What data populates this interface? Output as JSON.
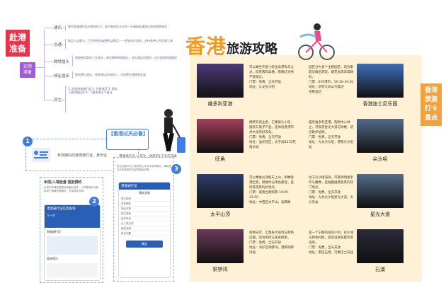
{
  "left_tag": "赴港\n准备",
  "center_tag": "实用\n准备",
  "mindmap": {
    "items": [
      {
        "label": "通讯",
        "desc": "使用港澳通行证办理电话卡；或下载电话卡应用—开通国际漫游后再到香港使用"
      },
      {
        "label": "交通",
        "desc": "购买八达通卡；可于地铁站或便利店购买——地铁出行首选，支持多种公共交通工具"
      },
      {
        "label": "跨境插头",
        "desc": "香港使用英标三孔插头，建议携带转换插头；部分酒店可借用，出行前提前准备好"
      },
      {
        "label": "预定酒店",
        "desc": "提前预订酒店；香港酒店房间较小，可选择交通便利区域"
      },
      {
        "label": "其它",
        "desc": "1. 办理港澳通行证 2. 兑换港币 3. 提前下载地图应用 4. 了解香港天气情况"
      }
    ]
  },
  "left_panel": {
    "step1": "1",
    "step1_text": "有效期内的港澳通行证、身份证",
    "step2": "2",
    "step2_title": "出境/入境检查 提前预约",
    "step2_text": "出境口岸通关需提前准备好证件，入境香港后可使用电子通道快速通关，节省排队时间。",
    "step3": "3",
    "bubble_title": "【香港过关必备】",
    "bubble_text": "港澳通行证 + 签注，请提前1个工作日确认签注有效",
    "step3_text": "签注信息可在小程序或公众号中查询确认，确保签注在有效期内并留意使用次数。",
    "phone1_header": "港澳通行证信息查询",
    "phone1_sub": "下一步",
    "phone1_label": "港澳通行证",
    "phone1_footer": "查询签注",
    "phone2_header": "港澳通行证",
    "phone2_title": "通关须知",
    "phone2_rows": [
      "签注种类",
      "有效期至",
      "剩余次数",
      "签注类别",
      "证件状态",
      "出入境记录",
      "相关说明",
      "常见问题"
    ],
    "phone2_button": "确定"
  },
  "guide": {
    "title_big": "香港",
    "title_small": "旅游攻略",
    "side_tag": "香港\n旅游\n打卡\n景点",
    "cells": [
      {
        "caption": "维多利亚港",
        "text": "可以乘坐天星小轮往返港岛与九龙，欣赏两岸高楼，夜晚灯光秀不容错过。\n门票：免费，全天开放\n地址：九龙尖沙咀",
        "color": "#4b3a7a"
      },
      {
        "caption": "香港迪士尼乐园",
        "text": "园区分为多个主题园区，适合家庭与情侣游玩，烟花表演非常精彩。\n门票：639港币，10:30-19:30\n地址：新界大屿山竹篙湾\n地铁直达",
        "color": "#3f6fb8"
      },
      {
        "caption": "旺角",
        "text": "拥挤的商业街，汇集街头小吃、服装与电子产品，是体验香港市井文化的好去处。\n门票：免费，全天开放\n地址：油尖旺区，太子站B2口/旺角东站",
        "color": "#a0405a"
      },
      {
        "caption": "尖沙咀",
        "text": "临近维多利亚港，购物中心林立，可观赏星光大道与钟楼，适合散步拍照。\n门票：免费，全天开放\n地址：九龙尖沙咀，港铁尖沙咀站",
        "color": "#556a8a"
      },
      {
        "caption": "太平山顶",
        "text": "可以乘坐山顶缆车上山，俯瞰香港全景，傍晚时分景色最佳，是欣赏夜景的好地点。\n门票：观景台需购票 10:00-22:00\n地址：中西区太平山，凌霄阁",
        "color": "#2e3d6a"
      },
      {
        "caption": "星光大道",
        "text": "位于尖沙咀海滨，可看到明星手印与雕像，是拍摄维港夜景的热门地点。\n门票：免费，全天开放\n地址：九龙尖沙咀星光大道，尖沙东站",
        "color": "#556c88"
      },
      {
        "caption": "铜锣湾",
        "text": "购物天堂，汇集各大商场与特色店铺，适合逛街与美食探索。\n门票：免费，全天开放\n地址：湾仔区铜锣湾，港铁铜锣湾站",
        "color": "#6a3a5a"
      },
      {
        "caption": "石澳",
        "text": "是一个宁静的海滨小村，有沙滩与特色村屋，适合远离喧嚣享受海风。\n门票：免费，全天开放\n地址：南区石澳，可乘巴士前往",
        "color": "#2a2a3a"
      }
    ]
  }
}
